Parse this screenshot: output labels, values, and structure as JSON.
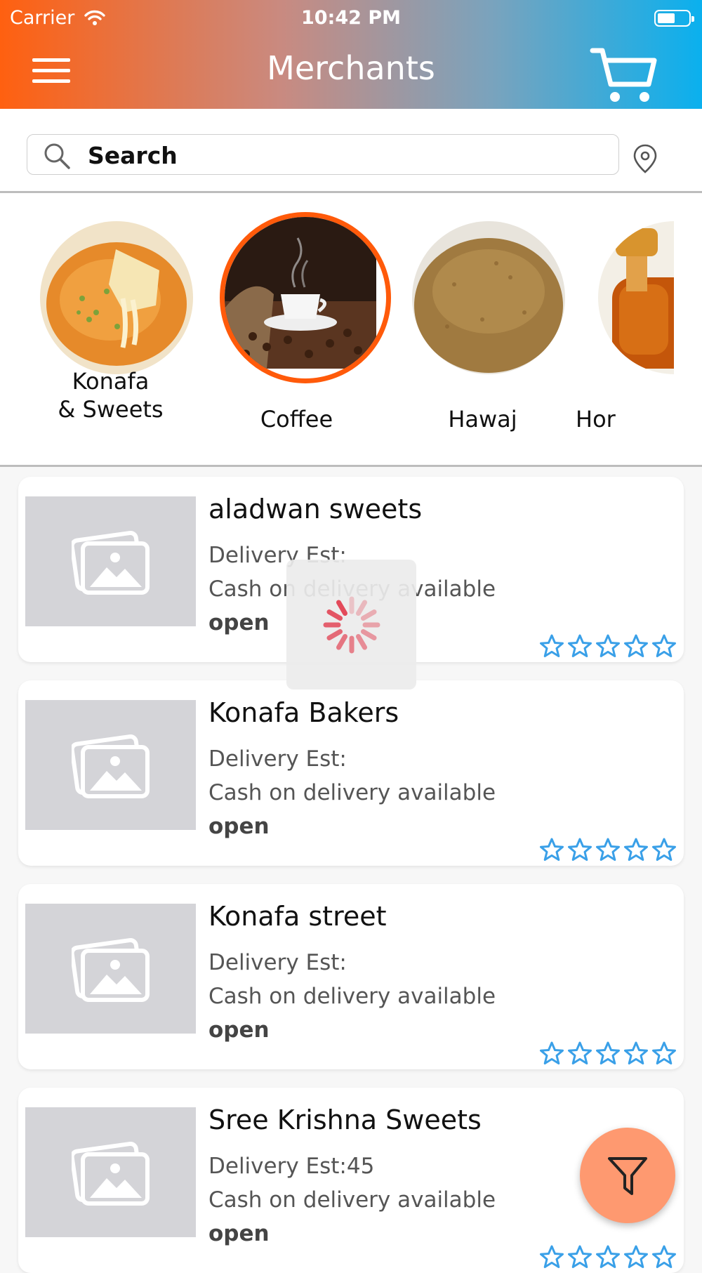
{
  "status_bar": {
    "carrier": "Carrier",
    "time": "10:42 PM"
  },
  "header": {
    "title": "Merchants",
    "icons": [
      "menu-icon",
      "cart-icon"
    ]
  },
  "search": {
    "placeholder": "Search",
    "icons": [
      "search-icon",
      "location-icon"
    ]
  },
  "categories": [
    {
      "label": "Konafa\n& Sweets",
      "selected": false
    },
    {
      "label": "Coffee",
      "selected": true
    },
    {
      "label": "Hawaj",
      "selected": false
    },
    {
      "label": "Hor",
      "selected": false
    }
  ],
  "merchants": [
    {
      "name": "aladwan sweets",
      "delivery": "Delivery Est:",
      "payment": "Cash on delivery available",
      "status": "open",
      "rating": 0
    },
    {
      "name": "Konafa Bakers",
      "delivery": "Delivery Est:",
      "payment": "Cash on delivery available",
      "status": "open",
      "rating": 0
    },
    {
      "name": "Konafa street",
      "delivery": "Delivery Est:",
      "payment": "Cash on delivery available",
      "status": "open",
      "rating": 0
    },
    {
      "name": "Sree Krishna Sweets",
      "delivery": "Delivery Est:45",
      "payment": "Cash on delivery available",
      "status": "open",
      "rating": 0
    }
  ],
  "colors": {
    "accent": "#ff5a0a",
    "star": "#3aa0e8",
    "fab": "#fe9970"
  },
  "fab": {
    "icon": "filter-icon"
  }
}
